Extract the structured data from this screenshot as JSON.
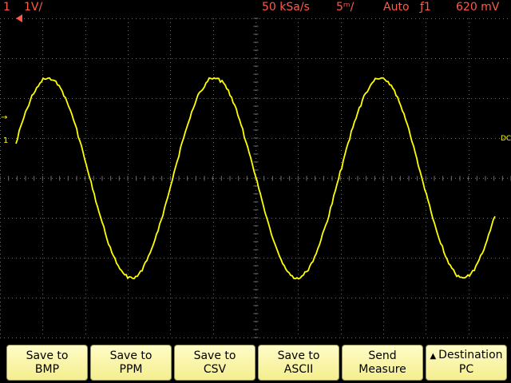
{
  "status": {
    "channel": "1",
    "vdiv": "1V/",
    "sample_rate": "50 kSa/s",
    "time_div": "5ᵐ/",
    "trigger_mode": "Auto",
    "trigger_icon": "ƒ1",
    "trigger_level": "620 mV"
  },
  "colors": {
    "status_text": "#ff5a4a",
    "trace": "#ffff00",
    "grid": "#6e6e6e",
    "softkey_bg": "#f7f2a6",
    "trigger_marker": "#ff5a4a"
  },
  "markers": {
    "channel_ground": "1",
    "trigger_level": "→",
    "ref_right": "DC"
  },
  "trace": {
    "channel": "1",
    "waveform": "sine",
    "amplitude_v": 2.5,
    "offset_v": 0,
    "cycles_visible": 3,
    "period_div": 3.9,
    "start_phase_deg": 20
  },
  "softkeys": [
    {
      "line1": "Save to",
      "line2": "BMP"
    },
    {
      "line1": "Save to",
      "line2": "PPM"
    },
    {
      "line1": "Save to",
      "line2": "CSV"
    },
    {
      "line1": "Save to",
      "line2": "ASCII"
    },
    {
      "line1": "Send",
      "line2": "Measure"
    },
    {
      "line1": "Destination",
      "line2": "PC",
      "icon": "up-triangle-icon"
    }
  ]
}
